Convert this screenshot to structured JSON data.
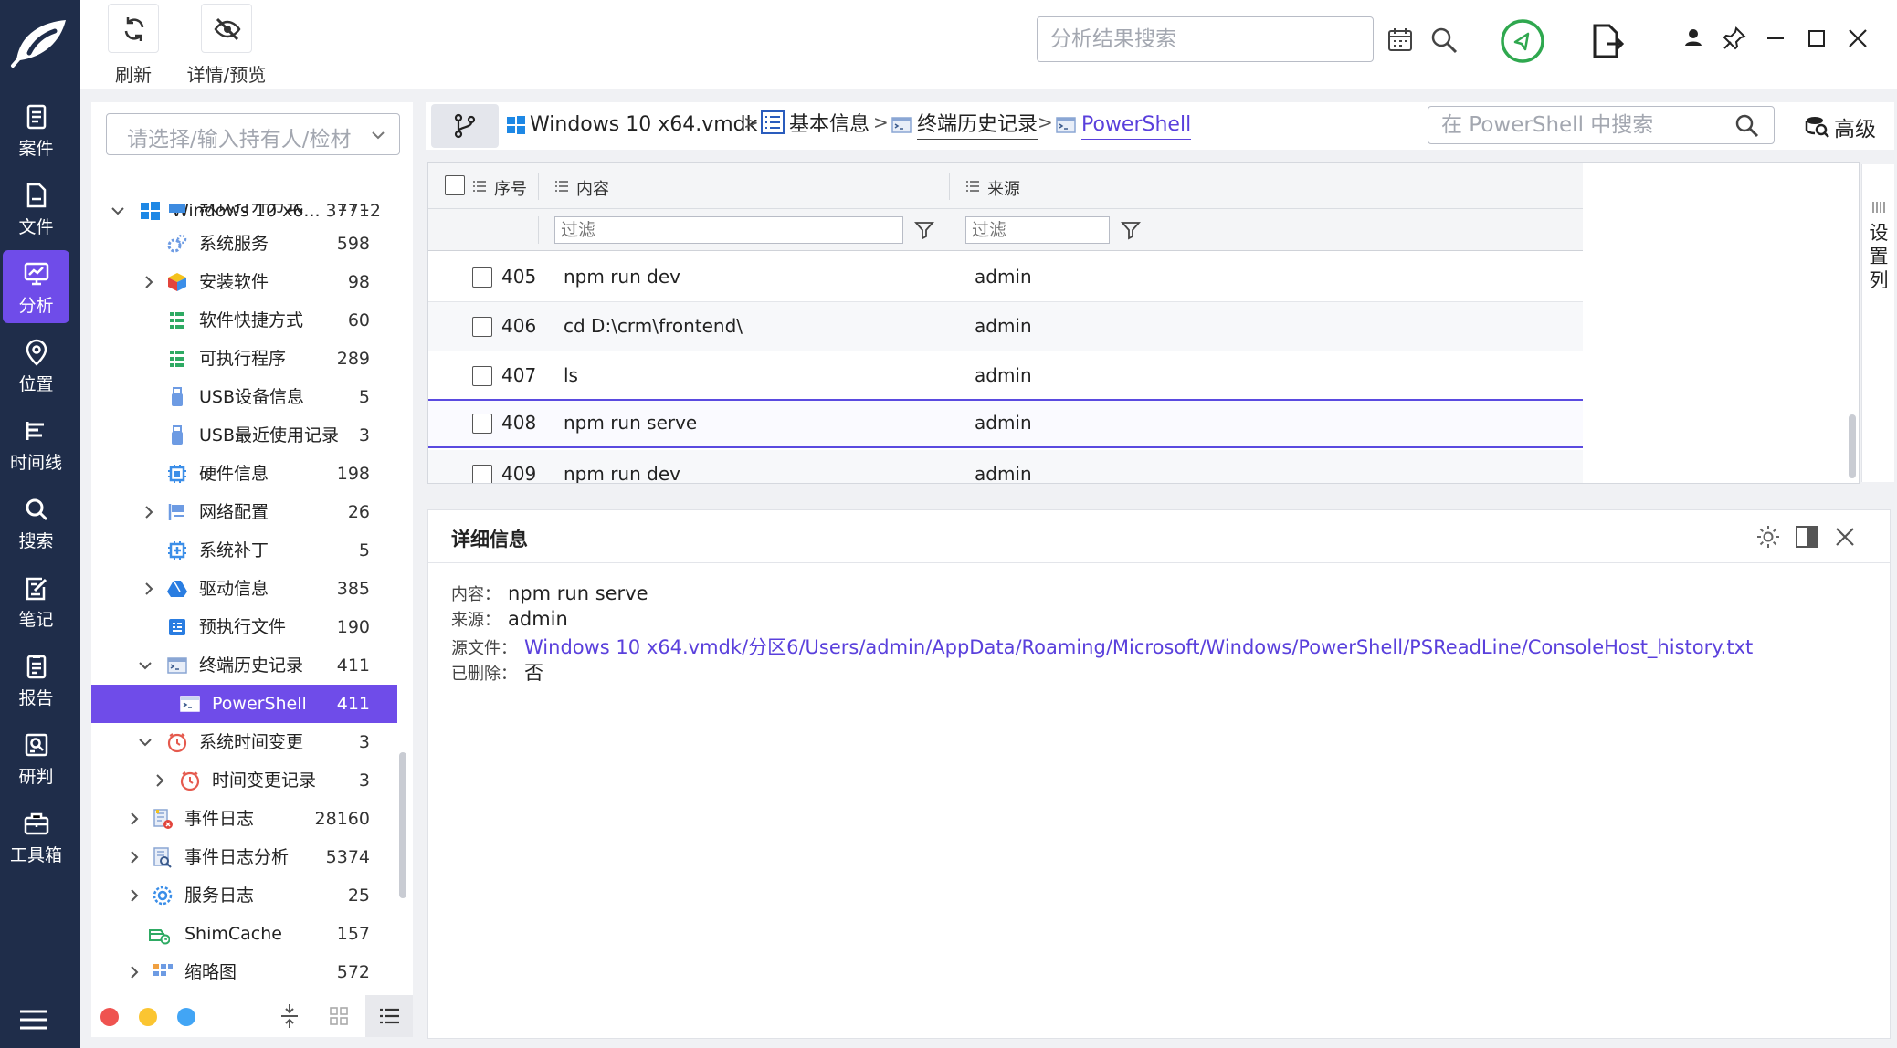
{
  "colors": {
    "nav_bg": "#1f2d4a",
    "accent": "#6f4ce9",
    "link": "#5a40dc"
  },
  "nav": {
    "items": [
      {
        "label": "案件",
        "icon": "case-icon"
      },
      {
        "label": "文件",
        "icon": "file-icon"
      },
      {
        "label": "分析",
        "icon": "analysis-icon",
        "active": true
      },
      {
        "label": "位置",
        "icon": "location-icon"
      },
      {
        "label": "时间线",
        "icon": "timeline-icon"
      },
      {
        "label": "搜索",
        "icon": "search-icon"
      },
      {
        "label": "笔记",
        "icon": "note-icon"
      },
      {
        "label": "报告",
        "icon": "report-icon"
      },
      {
        "label": "研判",
        "icon": "judge-icon"
      },
      {
        "label": "工具箱",
        "icon": "toolbox-icon"
      }
    ]
  },
  "toolbar": {
    "refresh_label": "刷新",
    "preview_label": "详情/预览",
    "search_placeholder": "分析结果搜索"
  },
  "tree": {
    "owner_placeholder": "请选择/输入持有人/检材",
    "items": [
      {
        "label": "Windows 10 x6...",
        "count": "37712",
        "icon": "windows-icon",
        "expanded": true
      },
      {
        "label": "默认打开方式",
        "count": "171",
        "icon": "app-icon"
      },
      {
        "label": "系统服务",
        "count": "598",
        "icon": "gears-icon"
      },
      {
        "label": "安装软件",
        "count": "98",
        "icon": "package-icon",
        "expandable": true
      },
      {
        "label": "软件快捷方式",
        "count": "60",
        "icon": "shortcut-list-icon"
      },
      {
        "label": "可执行程序",
        "count": "289",
        "icon": "exe-list-icon"
      },
      {
        "label": "USB设备信息",
        "count": "5",
        "icon": "usb-icon"
      },
      {
        "label": "USB最近使用记录",
        "count": "3",
        "icon": "usb-icon"
      },
      {
        "label": "硬件信息",
        "count": "198",
        "icon": "chip-icon"
      },
      {
        "label": "网络配置",
        "count": "26",
        "icon": "network-icon",
        "expandable": true
      },
      {
        "label": "系统补丁",
        "count": "5",
        "icon": "patch-icon"
      },
      {
        "label": "驱动信息",
        "count": "385",
        "icon": "drive-icon",
        "expandable": true
      },
      {
        "label": "预执行文件",
        "count": "190",
        "icon": "prefetch-icon"
      },
      {
        "label": "终端历史记录",
        "count": "411",
        "icon": "terminal-icon",
        "expanded": true
      },
      {
        "label": "PowerShell",
        "count": "411",
        "icon": "terminal-icon",
        "selected": true
      },
      {
        "label": "系统时间变更",
        "count": "3",
        "icon": "clock-icon",
        "expanded": true
      },
      {
        "label": "时间变更记录",
        "count": "3",
        "icon": "clock-icon",
        "expandable": true
      },
      {
        "label": "事件日志",
        "count": "28160",
        "icon": "event-log-icon",
        "expandable": true
      },
      {
        "label": "事件日志分析",
        "count": "5374",
        "icon": "log-analysis-icon",
        "expandable": true
      },
      {
        "label": "服务日志",
        "count": "25",
        "icon": "service-log-icon",
        "expandable": true
      },
      {
        "label": "ShimCache",
        "count": "157",
        "icon": "shimcache-icon"
      },
      {
        "label": "缩略图",
        "count": "572",
        "icon": "thumbnail-icon",
        "expandable": true
      }
    ]
  },
  "breadcrumb": {
    "items": [
      "Windows 10 x64.vmdk",
      "基本信息",
      "终端历史记录",
      "PowerShell"
    ],
    "separator": ">"
  },
  "search_ps": {
    "placeholder": "在 PowerShell 中搜索"
  },
  "advanced_label": "高级",
  "grid": {
    "columns": [
      "序号",
      "内容",
      "来源"
    ],
    "filter_placeholder": "过滤",
    "rows": [
      {
        "id": "405",
        "content": "npm run dev",
        "source": "admin"
      },
      {
        "id": "406",
        "content": "cd D:\\crm\\frontend\\",
        "source": "admin"
      },
      {
        "id": "407",
        "content": "ls",
        "source": "admin"
      },
      {
        "id": "408",
        "content": "npm run serve",
        "source": "admin",
        "selected": true
      },
      {
        "id": "409",
        "content": "npm run dev",
        "source": "admin"
      }
    ],
    "column_settings_label": "设置列"
  },
  "detail": {
    "title": "详细信息",
    "fields": [
      {
        "key": "内容：",
        "value": "npm run serve"
      },
      {
        "key": "来源：",
        "value": "admin"
      },
      {
        "key": "源文件：",
        "value": "Windows 10 x64.vmdk/分区6/Users/admin/AppData/Roaming/Microsoft/Windows/PowerShell/PSReadLine/ConsoleHost_history.txt",
        "link": true
      },
      {
        "key": "已删除：",
        "value": "否"
      }
    ]
  }
}
